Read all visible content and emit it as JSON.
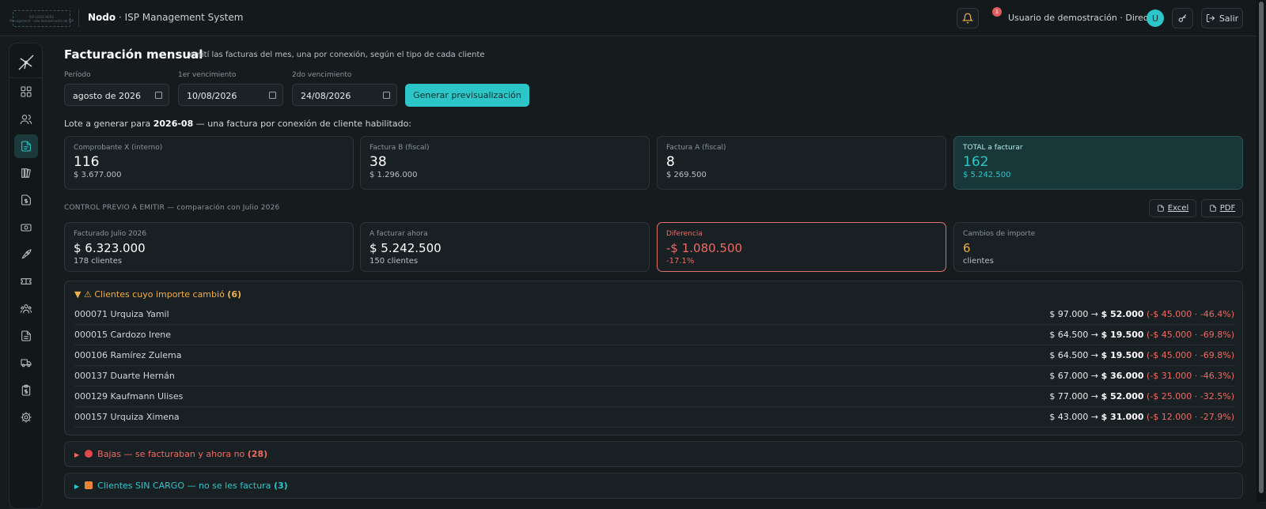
{
  "header": {
    "logo_line1": "ISP LOGO HERE",
    "logo_line2": "Management · solo demostración de ISP",
    "app_name": "Nodo",
    "app_subtitle": "· ISP Management System",
    "notifications_count": "1",
    "user_label": "Usuario de demostración · Director",
    "avatar_initial": "U",
    "logout_label": "Salir"
  },
  "page": {
    "title": "Facturación mensual",
    "subtitle": "emití las facturas del mes, una por conexión, según el tipo de cada cliente"
  },
  "form": {
    "periodo_label": "Período",
    "periodo_value": "agosto de 2026",
    "venc1_label": "1er vencimiento",
    "venc1_value": "10/08/2026",
    "venc2_label": "2do vencimiento",
    "venc2_value": "24/08/2026",
    "generate_button": "Generar previsualización"
  },
  "lote": {
    "prefix": "Lote a generar para",
    "period": "2026-08",
    "suffix": "— una factura por conexión de cliente habilitado:"
  },
  "summary_cards": [
    {
      "title": "Comprobante X (interno)",
      "count": "116",
      "amount": "$ 3.677.000"
    },
    {
      "title": "Factura B (fiscal)",
      "count": "38",
      "amount": "$ 1.296.000"
    },
    {
      "title": "Factura A (fiscal)",
      "count": "8",
      "amount": "$ 269.500"
    },
    {
      "title": "TOTAL a facturar",
      "count": "162",
      "amount": "$ 5.242.500"
    }
  ],
  "control": {
    "heading": "CONTROL PREVIO A EMITIR — comparación con Julio 2026",
    "excel_label": "Excel",
    "pdf_label": "PDF"
  },
  "control_cards": [
    {
      "title": "Facturado Julio 2026",
      "value": "$ 6.323.000",
      "sub": "178 clientes"
    },
    {
      "title": "A facturar ahora",
      "value": "$ 5.242.500",
      "sub": "150 clientes"
    },
    {
      "title": "Diferencia",
      "value": "-$ 1.080.500",
      "sub": "-17.1%"
    },
    {
      "title": "Cambios de importe",
      "value": "6",
      "sub": "clientes"
    }
  ],
  "changed": {
    "title": "Clientes cuyo importe cambió",
    "count": "(6)",
    "rows": [
      {
        "client": "000071 Urquiza Yamil",
        "old": "$ 97.000",
        "new": "$ 52.000",
        "delta": "(-$ 45.000 · -46.4%)"
      },
      {
        "client": "000015 Cardozo Irene",
        "old": "$ 64.500",
        "new": "$ 19.500",
        "delta": "(-$ 45.000 · -69.8%)"
      },
      {
        "client": "000106 Ramírez Zulema",
        "old": "$ 64.500",
        "new": "$ 19.500",
        "delta": "(-$ 45.000 · -69.8%)"
      },
      {
        "client": "000137 Duarte Hernán",
        "old": "$ 67.000",
        "new": "$ 36.000",
        "delta": "(-$ 31.000 · -46.3%)"
      },
      {
        "client": "000129 Kaufmann Ulises",
        "old": "$ 77.000",
        "new": "$ 52.000",
        "delta": "(-$ 25.000 · -32.5%)"
      },
      {
        "client": "000157 Urquiza Ximena",
        "old": "$ 43.000",
        "new": "$ 31.000",
        "delta": "(-$ 12.000 · -27.9%)"
      }
    ]
  },
  "bajas": {
    "title": "Bajas — se facturaban y ahora no",
    "count": "(28)"
  },
  "sin_cargo": {
    "title": "Clientes SIN CARGO — no se les factura",
    "count": "(3)"
  },
  "icons": [
    "bell-icon",
    "key-icon",
    "logout-icon",
    "dashboard-icon",
    "users-icon",
    "invoice-icon",
    "library-icon",
    "payment-doc-icon",
    "cash-icon",
    "rocket-icon",
    "ticket-icon",
    "team-icon",
    "report-icon",
    "truck-icon",
    "clipboard-icon",
    "gear-icon"
  ],
  "colors": {
    "accent": "#2cc6c9",
    "danger": "#ef6a63",
    "warning": "#f0b04a",
    "background": "#161b1e"
  }
}
